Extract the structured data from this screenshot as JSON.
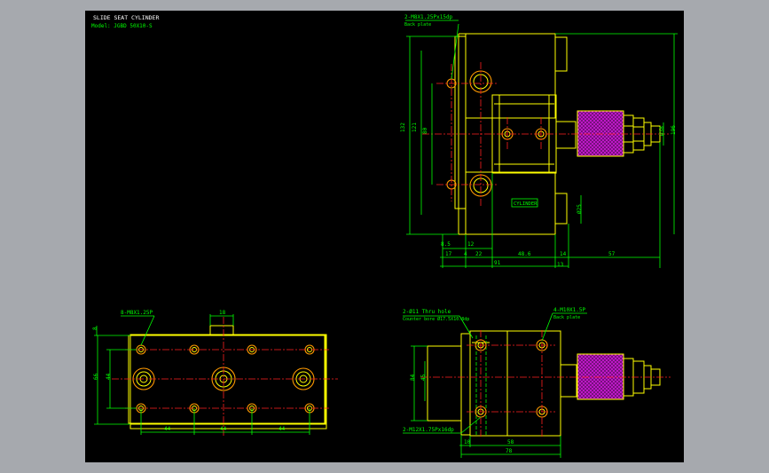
{
  "title": {
    "line1": "SLIDE SEAT CYLINDER",
    "line2": "Model: JGBD 50X10-S"
  },
  "brand_label": "CYLINDER",
  "colors": {
    "background": "#a6a9ae",
    "sheet": "#000000",
    "outline": "#ffff00",
    "dimension": "#00ff00",
    "centerline": "#ff2020",
    "hole": "#ff9a00",
    "knurl": "#cc1bd6"
  },
  "notes": {
    "top_right_thread": "2-M8X1.25Px15dp",
    "top_right_thread_sub": "Back plate",
    "bottom_left_thread": "8-M8X1.25P",
    "bottom_right_hole": "2-Ø11  Thru hole",
    "bottom_right_hole_sub": "Counter bore Ø17.5X10.8dp",
    "bottom_right_thread_top": "4-M10X1.5P",
    "bottom_right_thread_top_sub": "Back plate",
    "bottom_right_thread_bottom": "2-M12X1.75Px16dp"
  },
  "dimensions": {
    "top_right": {
      "height_total": "132",
      "height_mid": "121",
      "height_inner": "80",
      "left_small": "8.5",
      "d17": "17",
      "d4": "4",
      "d22": "22",
      "d12": "12",
      "d48": "48.6",
      "d14": "14",
      "d91": "91",
      "d13": "13",
      "d57": "57",
      "dia38": "Ø38",
      "dia25": "Ø25",
      "height_right": "196"
    },
    "bottom_left": {
      "top_w": "18",
      "left_top": "8",
      "height": "66",
      "height_inner": "44",
      "spacing1": "44",
      "spacing2": "44",
      "spacing3": "44"
    },
    "bottom_right": {
      "height_outer": "84",
      "height_inner": "45",
      "d10": "10",
      "d58": "58",
      "d78": "78"
    }
  }
}
